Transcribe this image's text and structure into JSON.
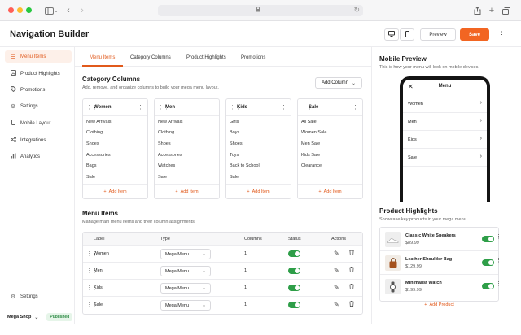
{
  "browser": {
    "colors": {
      "close": "#ff5f57",
      "minimize": "#febc2e",
      "maximize": "#28c840"
    },
    "icons": [
      "sidebar-toggle-icon",
      "back-icon",
      "forward-icon",
      "lock-icon",
      "reload-icon",
      "share-icon",
      "new-tab-icon",
      "tabs-icon"
    ]
  },
  "header": {
    "title": "Navigation Builder",
    "preview_label": "Preview",
    "save_label": "Save",
    "accent_color": "#f26522"
  },
  "sidebar": {
    "items": [
      {
        "label": "Menu Items",
        "icon": "menu-icon",
        "active": true
      },
      {
        "label": "Product Highlights",
        "icon": "image-icon",
        "active": false
      },
      {
        "label": "Promotions",
        "icon": "tag-icon",
        "active": false
      },
      {
        "label": "Settings",
        "icon": "gear-icon",
        "active": false
      },
      {
        "label": "Mobile Layout",
        "icon": "phone-icon",
        "active": false
      },
      {
        "label": "Integrations",
        "icon": "integrations-icon",
        "active": false
      },
      {
        "label": "Analytics",
        "icon": "chart-icon",
        "active": false
      }
    ],
    "bottom_settings": "Settings",
    "shop_name": "Mega Shop",
    "status": "Published"
  },
  "tabs": [
    "Menu Items",
    "Category Columns",
    "Product Highlights",
    "Promotions"
  ],
  "category_columns": {
    "title": "Category Columns",
    "description": "Add, remove, and organize columns to build your mega menu layout.",
    "add_column_label": "Add Column",
    "add_item_label": "Add Item",
    "columns": [
      {
        "name": "Women",
        "items": [
          "New Arrivals",
          "Clothing",
          "Shoes",
          "Accessories",
          "Bags",
          "Sale"
        ]
      },
      {
        "name": "Men",
        "items": [
          "New Arrivals",
          "Clothing",
          "Shoes",
          "Accessories",
          "Watches",
          "Sale"
        ]
      },
      {
        "name": "Kids",
        "items": [
          "Girls",
          "Boys",
          "Shoes",
          "Toys",
          "Back to School",
          "Sale"
        ]
      },
      {
        "name": "Sale",
        "items": [
          "All Sale",
          "Women Sale",
          "Men Sale",
          "Kids Sale",
          "Clearance"
        ]
      }
    ]
  },
  "menu_items": {
    "title": "Menu Items",
    "description": "Manage main menu items and their column assignments.",
    "headers": {
      "label": "Label",
      "type": "Type",
      "columns": "Columns",
      "status": "Status",
      "actions": "Actions"
    },
    "rows": [
      {
        "label": "Women",
        "type": "Mega Menu",
        "columns": "1"
      },
      {
        "label": "Men",
        "type": "Mega Menu",
        "columns": "1"
      },
      {
        "label": "Kids",
        "type": "Mega Menu",
        "columns": "1"
      },
      {
        "label": "Sale",
        "type": "Mega Menu",
        "columns": "1"
      }
    ]
  },
  "mobile_preview": {
    "title": "Mobile Preview",
    "description": "This is how your menu will look on mobile devices.",
    "menu_title": "Menu",
    "items": [
      "Women",
      "Men",
      "Kids",
      "Sale"
    ]
  },
  "product_highlights": {
    "title": "Product Highlights",
    "description": "Showcase key products in your mega menu.",
    "add_label": "Add Product",
    "products": [
      {
        "name": "Classic White Sneakers",
        "price": "$89.99"
      },
      {
        "name": "Leather Shoulder Bag",
        "price": "$129.99"
      },
      {
        "name": "Minimalist Watch",
        "price": "$199.99"
      }
    ]
  }
}
